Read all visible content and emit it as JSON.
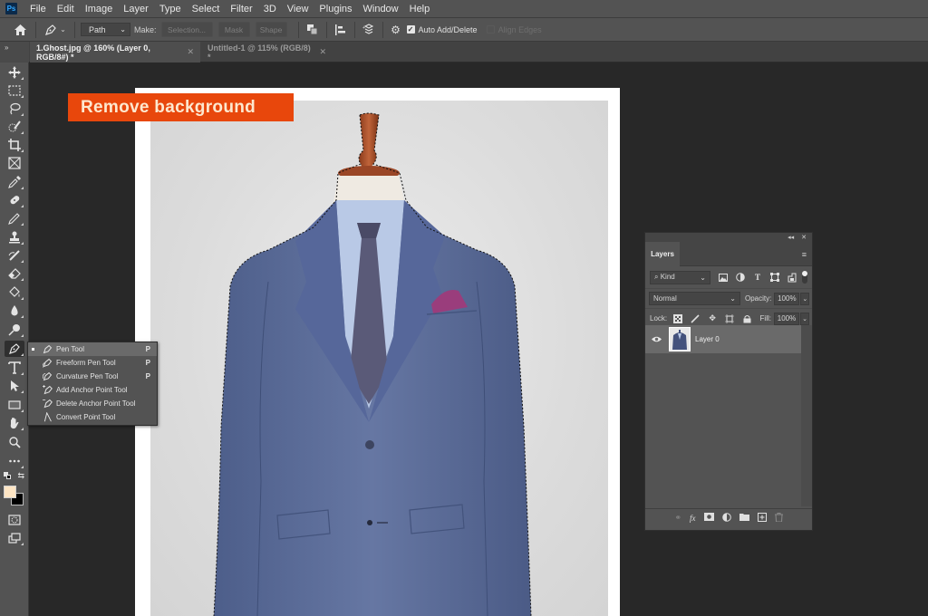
{
  "app": {
    "logo": "Ps"
  },
  "menu": [
    "File",
    "Edit",
    "Image",
    "Layer",
    "Type",
    "Select",
    "Filter",
    "3D",
    "View",
    "Plugins",
    "Window",
    "Help"
  ],
  "options_bar": {
    "mode_value": "Path",
    "make_label": "Make:",
    "buttons": [
      "Selection...",
      "Mask",
      "Shape"
    ],
    "auto_add_delete_label": "Auto Add/Delete",
    "auto_add_delete_checked": true,
    "align_edges_label": "Align Edges",
    "align_edges_checked": false
  },
  "tabs": [
    {
      "label": "1.Ghost.jpg @ 160% (Layer 0, RGB/8#) *",
      "active": true
    },
    {
      "label": "Untitled-1 @ 115% (RGB/8) *",
      "active": false
    }
  ],
  "toolstrip_collapse": "»",
  "tools": [
    "move",
    "marquee",
    "lasso",
    "quick-selection",
    "crop",
    "frame",
    "eyedropper",
    "healing-brush",
    "brush",
    "clone-stamp",
    "history-brush",
    "eraser",
    "paint-bucket",
    "blur",
    "dodge",
    "pen",
    "type",
    "path-selection",
    "rectangle",
    "hand",
    "zoom",
    "more",
    "default-colors",
    "swap-colors",
    "quick-mask",
    "screen-mode"
  ],
  "colors": {
    "foreground": "#fde5c4",
    "background": "#000000",
    "banner": "#e8470c",
    "banner_text": "#fde8cf"
  },
  "flyout": {
    "items": [
      {
        "label": "Pen Tool",
        "shortcut": "P",
        "active": true
      },
      {
        "label": "Freeform Pen Tool",
        "shortcut": "P",
        "active": false
      },
      {
        "label": "Curvature Pen Tool",
        "shortcut": "P",
        "active": false
      },
      {
        "label": "Add Anchor Point Tool",
        "shortcut": "",
        "active": false
      },
      {
        "label": "Delete Anchor Point Tool",
        "shortcut": "",
        "active": false
      },
      {
        "label": "Convert Point Tool",
        "shortcut": "",
        "active": false
      }
    ]
  },
  "banner": {
    "text": "Remove background"
  },
  "layers_panel": {
    "title": "Layers",
    "filter_kind": "Kind",
    "blend_mode": "Normal",
    "opacity_label": "Opacity:",
    "opacity_value": "100%",
    "lock_label": "Lock:",
    "fill_label": "Fill:",
    "fill_value": "100%",
    "layers": [
      {
        "name": "Layer 0",
        "visible": true
      }
    ]
  }
}
